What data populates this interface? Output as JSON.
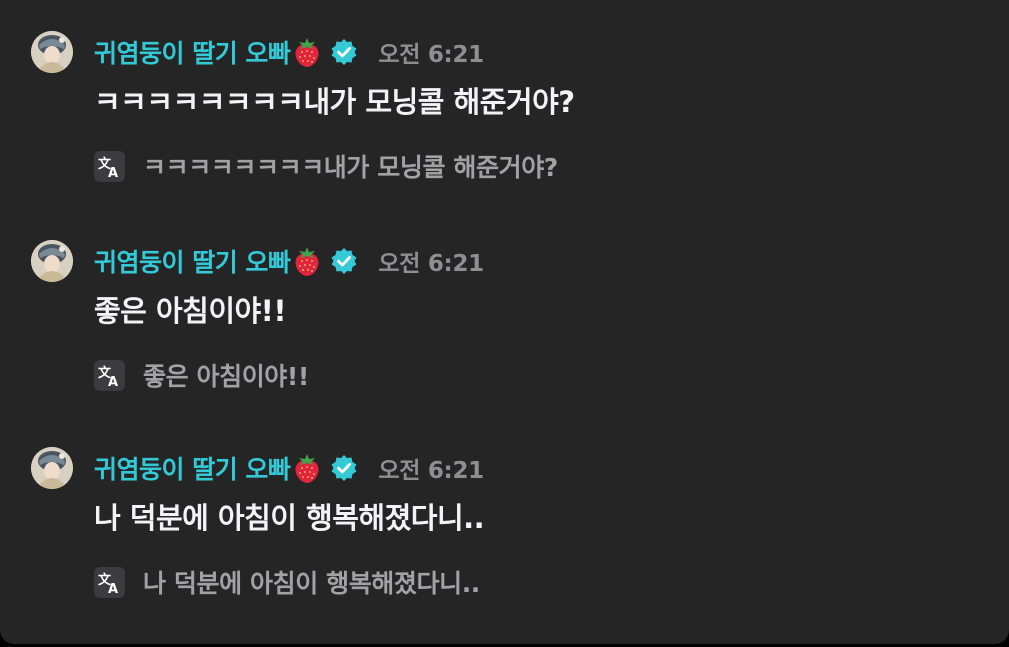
{
  "messages": [
    {
      "author": "귀염둥이 딸기 오빠",
      "time": "오전 6:21",
      "text": "ㅋㅋㅋㅋㅋㅋㅋㅋ내가 모닝콜 해준거야?",
      "translation": "ㅋㅋㅋㅋㅋㅋㅋㅋ내가 모닝콜 해준거야?"
    },
    {
      "author": "귀염둥이 딸기 오빠",
      "time": "오전 6:21",
      "text": "좋은 아침이야!!",
      "translation": "좋은 아침이야!!"
    },
    {
      "author": "귀염둥이 딸기 오빠",
      "time": "오전 6:21",
      "text": "나 덕분에 아침이 행복해졌다니..",
      "translation": "나 덕분에 아침이 행복해졌다니.."
    }
  ],
  "icons": {
    "author_emoji": "strawberry-icon",
    "badge": "verified-badge-icon",
    "translate": "translate-icon"
  },
  "colors": {
    "background": "#252526",
    "author": "#33c9d6",
    "verified_badge": "#33c9d6",
    "message_text": "#f3f3f5",
    "timestamp": "#8f8f93",
    "translation_text": "#a2a2a6"
  }
}
